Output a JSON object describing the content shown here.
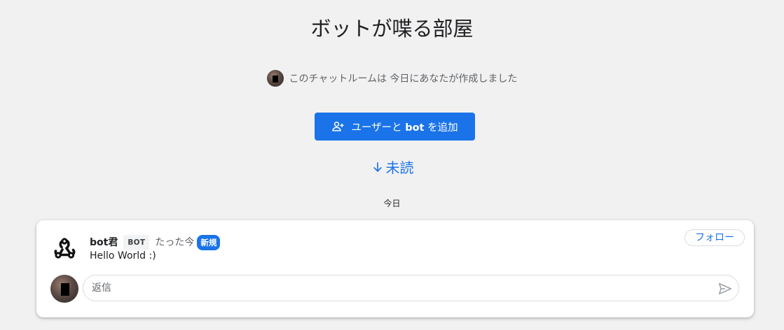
{
  "room": {
    "title": "ボットが喋る部屋",
    "creator_text": "このチャットルームは 今日にあなたが作成しました"
  },
  "actions": {
    "add_button_prefix": "ユーザーと ",
    "add_button_bold": "bot",
    "add_button_suffix": " を追加",
    "unread_label": "未読"
  },
  "timeline": {
    "date_divider": "今日"
  },
  "message": {
    "sender": "bot君",
    "sender_badge": "BOT",
    "timestamp": "たった今",
    "new_badge": "新規",
    "body": "Hello World :)",
    "follow_label": "フォロー",
    "reply_placeholder": "返信"
  },
  "icons": {
    "add_user": "person-add-icon",
    "unread_arrow": "arrow-down-icon",
    "bot_avatar": "webhook-icon",
    "send": "send-icon"
  },
  "colors": {
    "accent": "#1a73e8",
    "background": "#f1f1f1",
    "card": "#ffffff"
  }
}
